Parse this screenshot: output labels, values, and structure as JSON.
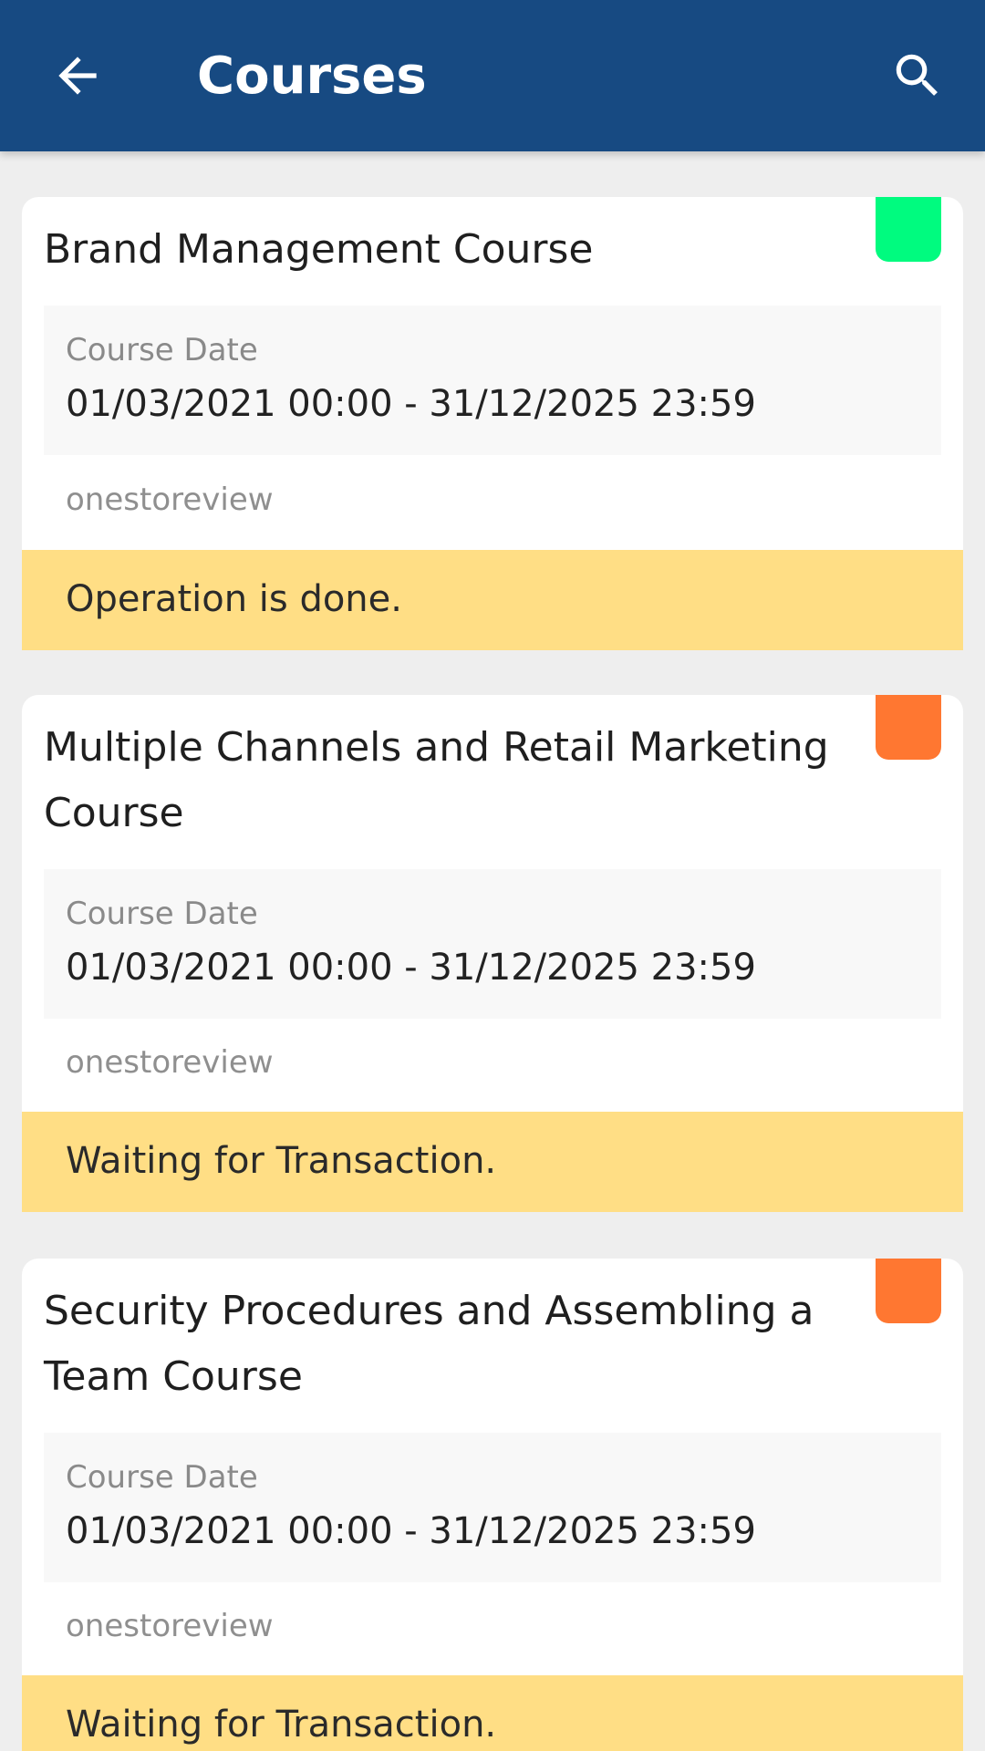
{
  "appbar": {
    "title": "Courses",
    "back_icon": "arrow-left-icon",
    "search_icon": "search-icon",
    "background": "#174A82"
  },
  "courses": [
    {
      "title": "Brand Management Course",
      "date_label": "Course Date",
      "date_value": "01/03/2021 00:00 - 31/12/2025 23:59",
      "vendor": "onestoreview",
      "status": "Operation is done.",
      "tag_color": "#00FB7F"
    },
    {
      "title": "Multiple Channels and Retail Marketing Course",
      "date_label": "Course Date",
      "date_value": "01/03/2021 00:00 - 31/12/2025 23:59",
      "vendor": "onestoreview",
      "status": "Waiting for Transaction.",
      "tag_color": "#FF7731"
    },
    {
      "title": "Security Procedures and Assembling a Team Course",
      "date_label": "Course Date",
      "date_value": "01/03/2021 00:00 - 31/12/2025 23:59",
      "vendor": "onestoreview",
      "status": "Waiting for Transaction.",
      "tag_color": "#FF7731"
    }
  ],
  "colors": {
    "status_bar": "#FFDE85",
    "page_background": "#EEEEEE"
  }
}
